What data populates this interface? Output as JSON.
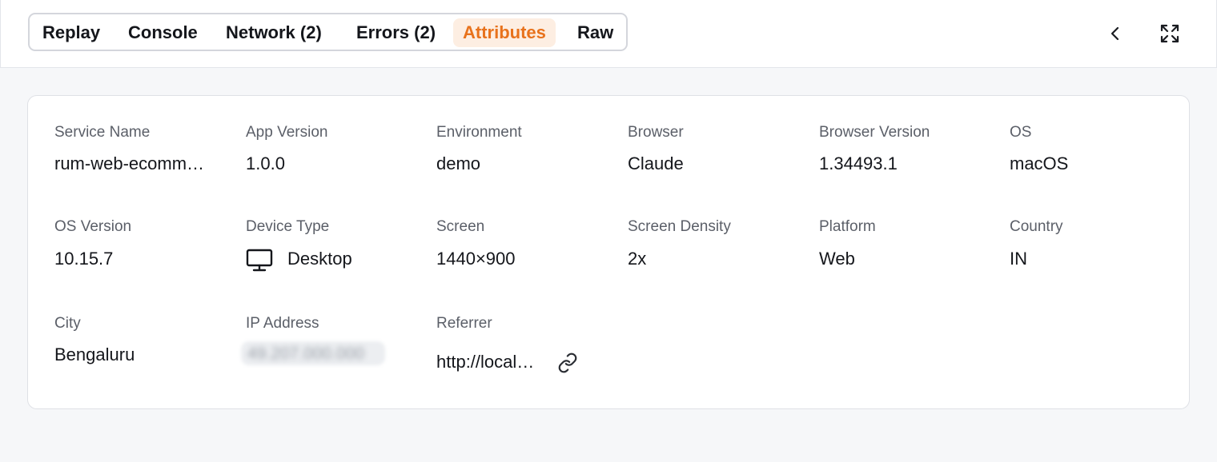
{
  "tabs": [
    {
      "label": "Replay",
      "active": false
    },
    {
      "label": "Console",
      "active": false
    },
    {
      "label": "Network (2)",
      "active": false
    },
    {
      "label": "Errors (2)",
      "active": false
    },
    {
      "label": "Attributes",
      "active": true
    },
    {
      "label": "Raw",
      "active": false
    }
  ],
  "header_icons": {
    "collapse": "chevron-left-icon",
    "expand": "expand-icon"
  },
  "attributes": {
    "service_name": {
      "label": "Service Name",
      "value": "rum-web-ecommerce"
    },
    "app_version": {
      "label": "App Version",
      "value": "1.0.0"
    },
    "environment": {
      "label": "Environment",
      "value": "demo"
    },
    "browser": {
      "label": "Browser",
      "value": "Claude"
    },
    "browser_version": {
      "label": "Browser Version",
      "value": "1.34493.1"
    },
    "os": {
      "label": "OS",
      "value": "macOS"
    },
    "os_version": {
      "label": "OS Version",
      "value": "10.15.7"
    },
    "device_type": {
      "label": "Device Type",
      "value": "Desktop",
      "icon": "monitor-icon"
    },
    "screen": {
      "label": "Screen",
      "value": "1440×900"
    },
    "screen_density": {
      "label": "Screen Density",
      "value": "2x"
    },
    "platform": {
      "label": "Platform",
      "value": "Web"
    },
    "country": {
      "label": "Country",
      "value": "IN"
    },
    "city": {
      "label": "City",
      "value": "Bengaluru"
    },
    "ip_address": {
      "label": "IP Address",
      "value": "49.207.000.000",
      "blurred": true
    },
    "referrer": {
      "label": "Referrer",
      "value": "http://localhost",
      "icon": "link-icon"
    }
  },
  "colors": {
    "accent": "#e8721c",
    "accent_bg": "#fdeee2",
    "label": "#5b5f68",
    "value": "#14161b",
    "page_bg": "#f6f7f9"
  }
}
